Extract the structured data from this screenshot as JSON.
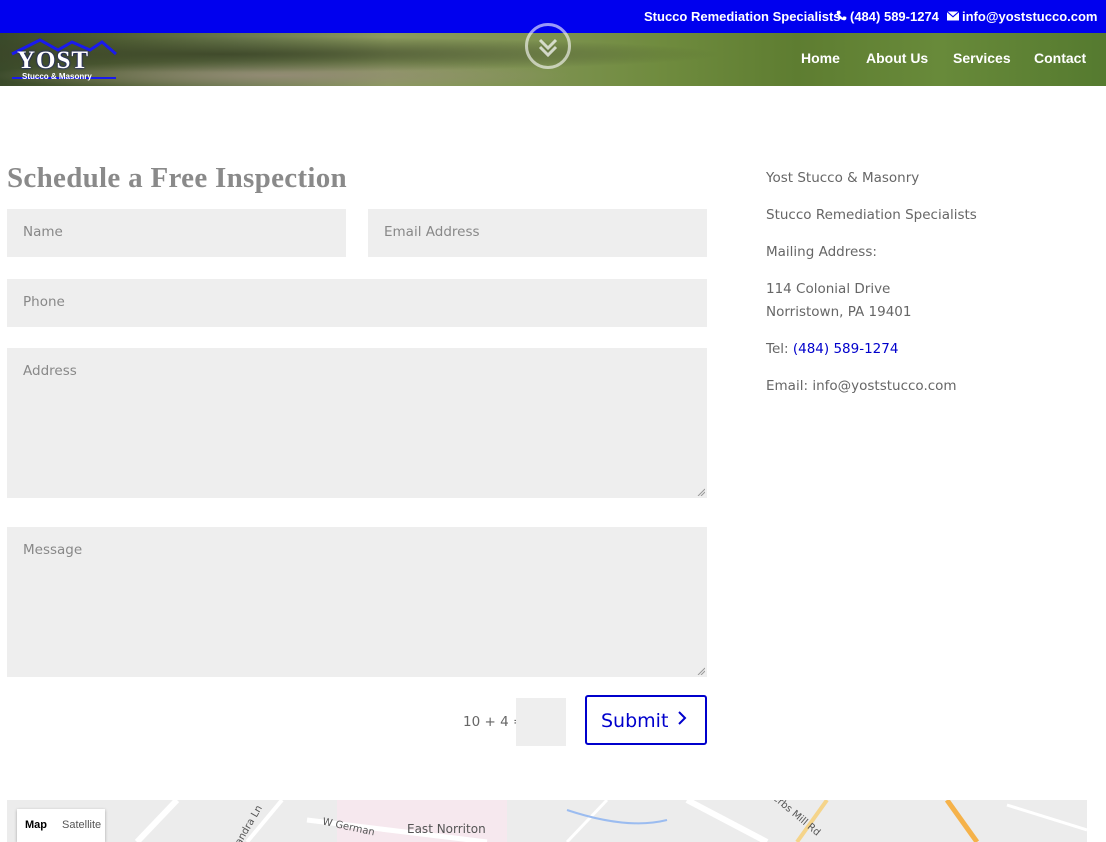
{
  "topbar": {
    "tagline": "Stucco Remediation Specialists",
    "phone": "(484) 589-1274",
    "email": "info@yoststucco.com",
    "phone_icon": "phone-icon",
    "email_icon": "envelope-icon",
    "background": "#0000ee"
  },
  "logo": {
    "word": "YOST",
    "sub": "Stucco & Masonry"
  },
  "nav": {
    "home": "Home",
    "about": "About Us",
    "services": "Services",
    "contact": "Contact"
  },
  "form": {
    "heading": "Schedule a Free Inspection",
    "name_placeholder": "Name",
    "email_placeholder": "Email Address",
    "phone_placeholder": "Phone",
    "address_placeholder": "Address",
    "message_placeholder": "Message",
    "captcha_question": "10 + 4 =",
    "submit_label": "Submit",
    "accent": "#0000cc"
  },
  "contact_info": {
    "company": "Yost Stucco & Masonry",
    "tagline": "Stucco Remediation Specialists",
    "mailing_label": "Mailing Address:",
    "street": "114 Colonial Drive",
    "city": "Norristown, PA 19401",
    "tel_label": "Tel:",
    "tel": "(484) 589-1274",
    "email_label": "Email:",
    "email": "info@yoststucco.com"
  },
  "map": {
    "map_button": "Map",
    "satellite_button": "Satellite",
    "place_label": "East Norriton",
    "street_label": "W German",
    "street_label2": "andra Ln",
    "street_label3": "erbs Mill Rd"
  }
}
